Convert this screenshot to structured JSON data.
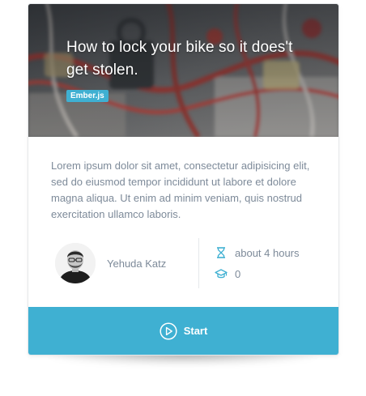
{
  "course": {
    "title": "How to lock your bike so it does't get stolen.",
    "tag": "Ember.js",
    "description": "Lorem ipsum dolor sit amet, consectetur adipisicing elit, sed do eiusmod tempor incididunt ut labore et dolore magna aliqua. Ut enim ad minim veniam, quis nostrud exercitation ullamco laboris."
  },
  "author": {
    "name": "Yehuda Katz"
  },
  "meta": {
    "duration": "about 4 hours",
    "duration_icon": "hourglass-icon",
    "students": "0",
    "students_icon": "graduation-cap-icon"
  },
  "action": {
    "start_label": "Start",
    "start_icon": "play-circle-icon"
  },
  "colors": {
    "accent": "#3fb0d2",
    "text_muted": "#7d8a99"
  }
}
